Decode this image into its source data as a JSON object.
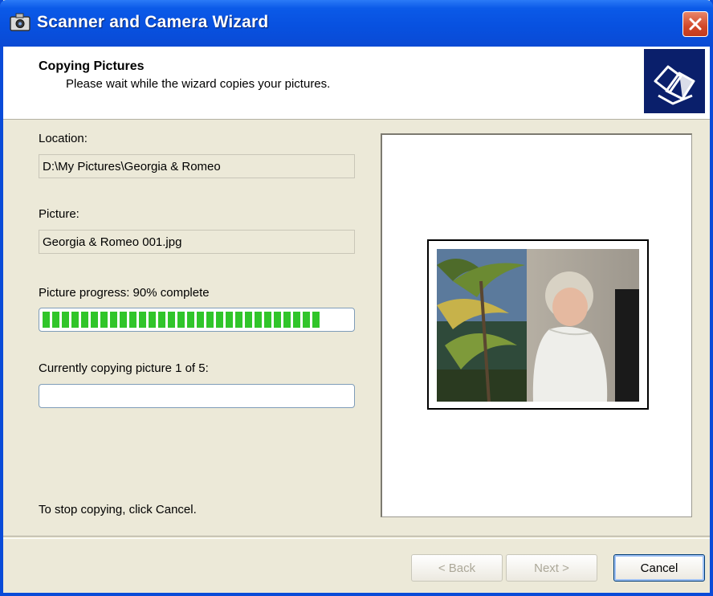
{
  "window": {
    "title": "Scanner and Camera Wizard"
  },
  "header": {
    "title": "Copying Pictures",
    "subtitle": "Please wait while the wizard copies your pictures."
  },
  "location": {
    "label": "Location:",
    "value": "D:\\My Pictures\\Georgia & Romeo"
  },
  "picture": {
    "label": "Picture:",
    "value": "Georgia & Romeo 001.jpg"
  },
  "picture_progress": {
    "label": "Picture progress: 90% complete",
    "percent": 90
  },
  "overall_progress": {
    "label": "Currently copying picture 1 of 5:",
    "percent": 0
  },
  "footer_note": "To stop copying, click Cancel.",
  "buttons": {
    "back": "< Back",
    "next": "Next >",
    "cancel": "Cancel"
  },
  "icons": {
    "title_icon": "camera-icon",
    "close": "close-icon",
    "wizard": "photo-copy-icon"
  },
  "colors": {
    "titlebar": "#0851e0",
    "progress": "#31c52a",
    "close": "#d2482a"
  }
}
